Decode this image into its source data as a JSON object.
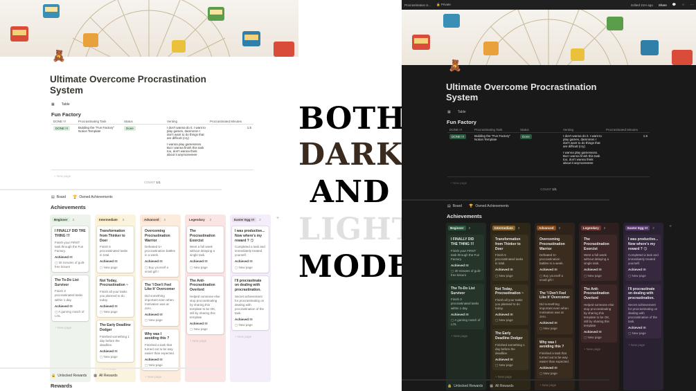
{
  "overlay_words": [
    "BOTH",
    "DARK",
    "AND",
    "LIGHT",
    "MODE"
  ],
  "colors": {
    "both": "#000000",
    "dark": "#3b2a1e",
    "and": "#000000",
    "light": "#e0e0e0",
    "mode": "#000000"
  },
  "dark_topbar": {
    "tab": "Procrastination S...",
    "privacy": "Private",
    "edited": "Edited 21m ago",
    "share": "Share"
  },
  "page": {
    "title_line1": "Ultimate Overcome Procrastination",
    "title_line2": "System",
    "view_label": "Table",
    "database_title": "Fun Factory",
    "columns": [
      "DONE !!!",
      "Procrastinating Task",
      "Status",
      "Venting",
      "Procrastinated Minutes"
    ],
    "row": {
      "done": "DONE !!!",
      "task": "Building the \"Fun Factory\" Notion Template",
      "status": "Done",
      "vent1": "I don't wanna do it. I want to play games, dammnnn I don't want to do things that are difficult (cry)",
      "vent2": "I wanna play gamesssss. But I wanna finish this task too, don't wanna think about it anymoreeeee",
      "minutes": "1.5"
    },
    "new_page": "New page",
    "count_label": "COUNT",
    "count_value": "1/1",
    "board_tab": "Board",
    "owned_tab": "Owned Achievements",
    "achievements_title": "Achievements",
    "rewards_tab1": "Unlocked Rewards",
    "rewards_tab2": "All Rewards",
    "rewards_title": "Rewards"
  },
  "board": [
    {
      "name": "Beginner",
      "count": "3",
      "light_bg": "#eef3ed",
      "light_tag": "#dbeddb",
      "dark_bg": "#1f2b22",
      "dark_tag": "#2b593f",
      "cards": [
        {
          "title": "I FINALLY DID THE THING !!!",
          "desc": "Finish your FIRST task through the Fun Factory.",
          "ach": "Achieved !!!",
          "extra": "30 minutes of guilt-free leisure"
        },
        {
          "title": "The To-Do List Survivor",
          "desc": "Finish 3 procrastinated tasks within 1 day.",
          "ach": "Achieved !!!",
          "extra": "A gaming match of LOL"
        }
      ]
    },
    {
      "name": "Intermediate",
      "count": "3",
      "light_bg": "#faf3dd",
      "light_tag": "#fdecc8",
      "dark_bg": "#2c2716",
      "dark_tag": "#89632a",
      "cards": [
        {
          "title": "Transformation from Thinker to Doer",
          "desc": "Finish 5 procrastinated tasks in total.",
          "ach": "Achieved !!!",
          "extra": "New page"
        },
        {
          "title": "Not Today, Procrastination ~",
          "desc": "Finish all your tasks you planned to do today.",
          "ach": "Achieved !!!",
          "extra": "New page"
        },
        {
          "title": "The Early Deadline Dodger",
          "desc": "Finished something 1 day before the deadline.",
          "ach": "Achieved !!!",
          "extra": "New page"
        }
      ]
    },
    {
      "name": "Advanced",
      "count": "3",
      "light_bg": "#fbecdd",
      "light_tag": "#fadec9",
      "dark_bg": "#2e231a",
      "dark_tag": "#854c1d",
      "cards": [
        {
          "title": "Overcoming Procrastination Warrior",
          "desc": "Defeated 5+ procrastination battles in a week.",
          "ach": "Achieved !!!",
          "extra": "Buy yourself a small gift !"
        },
        {
          "title": "The 'I Don't Feel Like It' Overcomer",
          "desc": "Did something important even when motivation was at zero.",
          "ach": "Achieved !!!",
          "extra": "New page"
        },
        {
          "title": "Why was I avoiding this ?",
          "desc": "Finished a task that turned out to be way easier than expected.",
          "ach": "Achieved !!!",
          "extra": "New page"
        }
      ]
    },
    {
      "name": "Legendary",
      "count": "2",
      "light_bg": "#fbe4e4",
      "light_tag": "#ffe2dd",
      "dark_bg": "#2e1f1f",
      "dark_tag": "#6e3630",
      "cards": [
        {
          "title": "The Procrastination Exorcist",
          "desc": "Went a full week without delaying a single task.",
          "ach": "Achieved !!!",
          "extra": "New page"
        },
        {
          "title": "The Anti-Procrastination Overlord",
          "desc": "Helped someone else stop procrastinating by sharing this template to be OK, still by sharing this template",
          "ach": "Achieved !!!",
          "extra": "New page"
        }
      ]
    },
    {
      "name": "Easter Egg !!!",
      "count": "2",
      "light_bg": "#f4eefb",
      "light_tag": "#e8deee",
      "dark_bg": "#2a2133",
      "dark_tag": "#5a3a6e",
      "cards": [
        {
          "title": "I was productive... Now where's my reward ? 😏",
          "desc": "Completed a task and immediately treated yourself.",
          "ach": "Achieved !!!",
          "extra": "New page"
        },
        {
          "title": "I'll procrastinate on dealing with procrastination.",
          "desc": "Secret achievement for procrastinating on dealing with procrastination of the task.",
          "ach": "Achieved !!!",
          "extra": "New page"
        }
      ]
    }
  ]
}
